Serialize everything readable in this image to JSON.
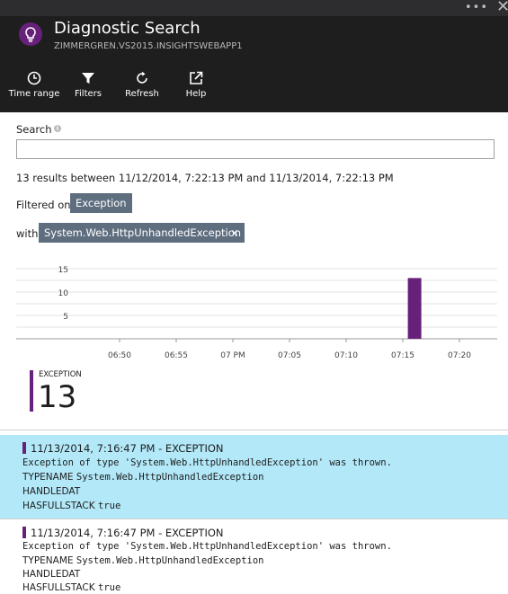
{
  "window": {
    "more_label": "•••",
    "close_label": "✕"
  },
  "header": {
    "title": "Diagnostic Search",
    "subtitle": "ZIMMERGREN.VS2015.INSIGHTSWEBAPP1",
    "app_icon": "lightbulb-icon"
  },
  "toolbar": [
    {
      "label": "Time range",
      "icon": "clock-icon"
    },
    {
      "label": "Filters",
      "icon": "funnel-icon"
    },
    {
      "label": "Refresh",
      "icon": "refresh-icon"
    },
    {
      "label": "Help",
      "icon": "external-link-icon"
    }
  ],
  "search": {
    "label": "Search",
    "value": "",
    "placeholder": ""
  },
  "summary": {
    "count": "13",
    "between_text": "results between",
    "start": "11/12/2014, 7:22:13 PM",
    "and_text": "and",
    "end": "11/13/2014, 7:22:13 PM"
  },
  "filters": {
    "filtered_on_label": "Filtered on",
    "filter_value": "Exception",
    "with_label": "with",
    "with_value": "System.Web.HttpUnhandledException",
    "remove_label": "×"
  },
  "chart_data": {
    "type": "bar",
    "x": [
      "06:50",
      "06:55",
      "07 PM",
      "07:05",
      "07:10",
      "07:15",
      "07:20"
    ],
    "yticks": [
      5,
      10,
      15
    ],
    "ylim": [
      0,
      15
    ],
    "bars": [
      {
        "time_minutes_after_0645": 31,
        "value": 13
      }
    ],
    "bar_color": "#68217a"
  },
  "stat": {
    "label": "EXCEPTION",
    "value": "13",
    "color": "#68217a"
  },
  "results": [
    {
      "header": "11/13/2014, 7:16:47 PM - EXCEPTION",
      "message": "Exception of type 'System.Web.HttpUnhandledException' was thrown.",
      "typename_key": "TYPENAME",
      "typename_value": "System.Web.HttpUnhandledException",
      "handledat_key": "HANDLEDAT",
      "hasfullstack_key": "HASFULLSTACK",
      "hasfullstack_value": "true",
      "selected": true
    },
    {
      "header": "11/13/2014, 7:16:47 PM - EXCEPTION",
      "message": "Exception of type 'System.Web.HttpUnhandledException' was thrown.",
      "typename_key": "TYPENAME",
      "typename_value": "System.Web.HttpUnhandledException",
      "handledat_key": "HANDLEDAT",
      "hasfullstack_key": "HASFULLSTACK",
      "hasfullstack_value": "true",
      "selected": false
    }
  ],
  "colors": {
    "header_bg": "#1e1e1e",
    "accent": "#68217a",
    "selected_bg": "#b2e8f8",
    "pill_bg": "#5f6e7f"
  }
}
